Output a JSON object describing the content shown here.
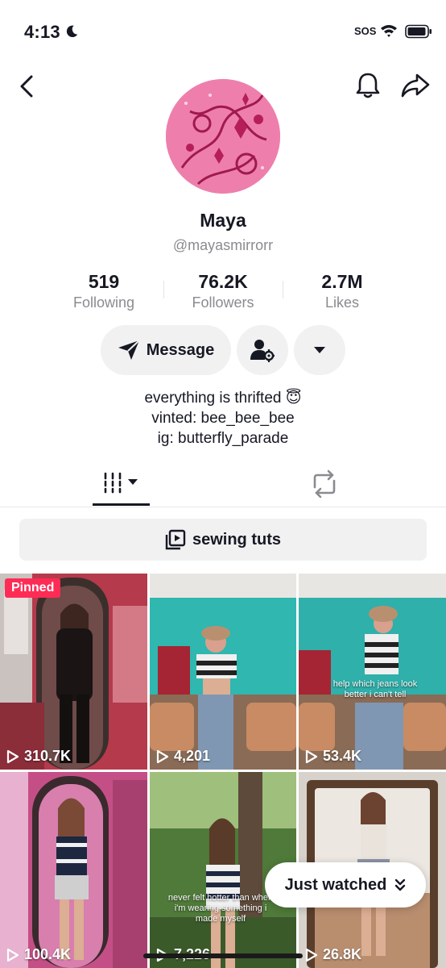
{
  "status_bar": {
    "time": "4:13",
    "sos": "SOS"
  },
  "profile": {
    "name": "Maya",
    "handle": "@mayasmirrorr"
  },
  "stats": [
    {
      "value": "519",
      "label": "Following"
    },
    {
      "value": "76.2K",
      "label": "Followers"
    },
    {
      "value": "2.7M",
      "label": "Likes"
    }
  ],
  "actions": {
    "message_label": "Message"
  },
  "bio": {
    "line1": "everything is thrifted 😇",
    "line2": "vinted: bee_bee_bee",
    "line3": "ig: butterfly_parade"
  },
  "playlist": {
    "label": "sewing tuts"
  },
  "videos": [
    {
      "views": "310.7K",
      "pinned_label": "Pinned"
    },
    {
      "views": "4,201"
    },
    {
      "views": "53.4K",
      "caption": "help which jeans look better i can't tell"
    },
    {
      "views": "100.4K"
    },
    {
      "views": "7,226",
      "caption": "never felt hotter than when i'm wearing something i made myself"
    },
    {
      "views": "26.8K"
    }
  ],
  "just_watched": {
    "label": "Just watched"
  },
  "colors": {
    "accent": "#fe2c55",
    "text": "#161823",
    "muted": "#8a8b91",
    "button_bg": "#f1f1f2"
  },
  "icons": [
    "moon-icon",
    "wifi-icon",
    "battery-icon",
    "back-arrow-icon",
    "bell-icon",
    "share-icon",
    "send-icon",
    "add-friend-icon",
    "caret-down-icon",
    "grid-icon",
    "repost-icon",
    "playlist-icon",
    "play-icon",
    "double-chevron-icon"
  ]
}
